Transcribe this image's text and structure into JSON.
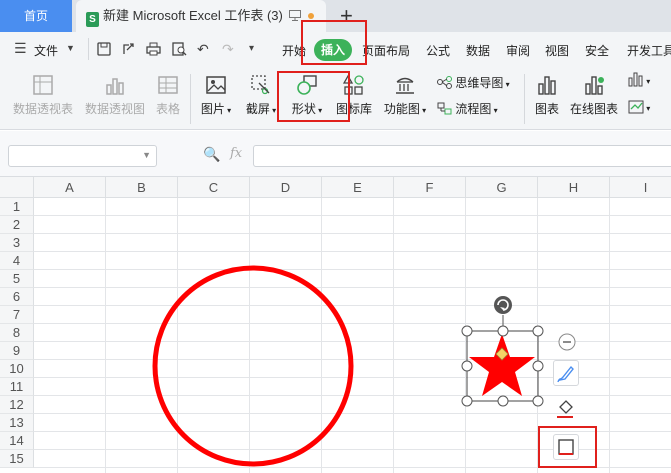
{
  "tabs": {
    "home": "首页",
    "doc_icon": "S",
    "doc": "新建 Microsoft Excel 工作表 (3)",
    "new_tab": "+"
  },
  "menu": {
    "file": "文件",
    "items": [
      "开始",
      "插入",
      "页面布局",
      "公式",
      "数据",
      "审阅",
      "视图",
      "安全",
      "开发工具"
    ]
  },
  "ribbon": {
    "pivot_table": "数据透视表",
    "pivot_chart": "数据透视图",
    "table": "表格",
    "picture": "图片",
    "screenshot": "截屏",
    "shapes": "形状",
    "icon_lib": "图标库",
    "func_chart": "功能图",
    "mindmap": "思维导图",
    "flowchart": "流程图",
    "chart": "图表",
    "online_chart": "在线图表"
  },
  "formula_bar": {
    "fx": "fx",
    "name_box": "",
    "content": ""
  },
  "columns": [
    "A",
    "B",
    "C",
    "D",
    "E",
    "F",
    "G",
    "H",
    "I"
  ],
  "rows": [
    "1",
    "2",
    "3",
    "4",
    "5",
    "6",
    "7",
    "8",
    "9",
    "10",
    "11",
    "12",
    "13",
    "14",
    "15"
  ],
  "colors": {
    "accent_green": "#3cb25a",
    "home_tab_blue": "#4a8ef0",
    "shape_red": "#ff0000",
    "highlight_red": "#e0201c",
    "star_handle_yellow": "#f5d565"
  }
}
